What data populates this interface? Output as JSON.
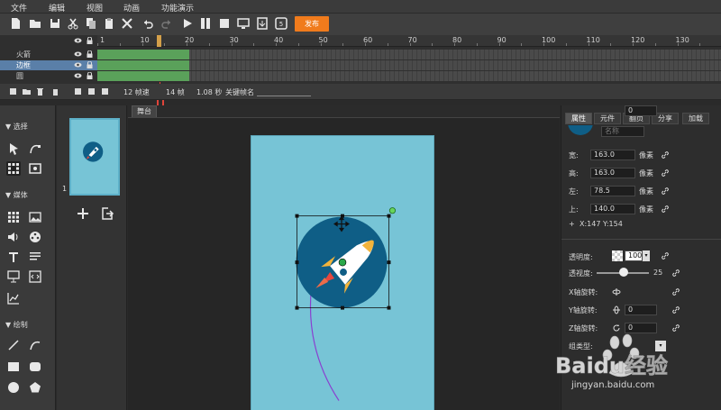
{
  "menu": [
    "文件",
    "编辑",
    "视图",
    "动画",
    "功能演示"
  ],
  "toolbar": {
    "publish_label": "发布"
  },
  "timeline": {
    "ruler": [
      "1",
      "10",
      "20",
      "30",
      "40",
      "50",
      "60",
      "70",
      "80",
      "90",
      "100",
      "110",
      "120",
      "130"
    ],
    "layers": [
      {
        "name": "火箭",
        "selected": false
      },
      {
        "name": "边框",
        "selected": true
      },
      {
        "name": "圆",
        "selected": false
      }
    ],
    "colors": {
      "frames": "#5aa15a",
      "playhead": "#e0443a",
      "selected_layer": "#5a7fa8"
    }
  },
  "status": {
    "fps": "12 帧速",
    "frame": "14 帧",
    "time": "1.08 秒",
    "keyframe_label": "关键帧名"
  },
  "tools": {
    "select_header": "选择",
    "media_header": "媒体",
    "draw_header": "绘制"
  },
  "scenes": {
    "number": "1"
  },
  "stage": {
    "tab": "舞台"
  },
  "props": {
    "tabs": [
      "属性",
      "元件",
      "翻页",
      "分享",
      "加载"
    ],
    "name_placeholder": "名称",
    "width_label": "宽:",
    "width_value": "163.0",
    "height_label": "高:",
    "height_value": "163.0",
    "left_label": "左:",
    "left_value": "78.5",
    "top_label": "上:",
    "top_value": "140.0",
    "unit": "像素",
    "coords": "X:147   Y:154",
    "opacity_label": "透明度:",
    "opacity_value": "100",
    "perspective_label": "透视度:",
    "perspective_value": "25",
    "xrot_label": "X轴旋转:",
    "xrot_value": "0",
    "yrot_label": "Y轴旋转:",
    "yrot_value": "0",
    "zrot_label": "Z轴旋转:",
    "zrot_value": "0",
    "group_label": "组类型:"
  },
  "watermark": {
    "brand": "Baidu经验",
    "url": "jingyan.baidu.com"
  }
}
